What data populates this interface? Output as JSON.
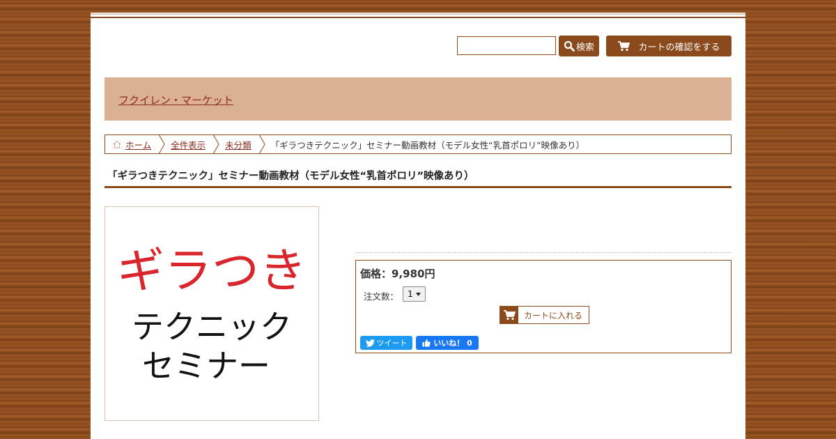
{
  "header": {
    "search_value": "",
    "search_button_label": "検索",
    "cart_button_label": "カートの確認をする"
  },
  "shop": {
    "name": "フクイレン・マーケット"
  },
  "breadcrumb": {
    "items": [
      "ホーム",
      "全件表示",
      "未分類"
    ],
    "current": "「ギラつきテクニック」セミナー動画教材（モデル女性“乳首ポロリ”映像あり）"
  },
  "product": {
    "title": "「ギラつきテクニック」セミナー動画教材（モデル女性“乳首ポロリ”映像あり）",
    "image_text": {
      "line1": "ギラつき",
      "line2": "テクニック",
      "line3": "セミナー"
    },
    "price_label": "価格：9,980円",
    "quantity_label": "注文数：",
    "quantity_value": "1",
    "add_to_cart_label": "カートに入れる",
    "tweet_label": "ツイート",
    "like_label": "いいね！ 0"
  },
  "colors": {
    "accent": "#8a4a1c",
    "banner": "#dcb093",
    "link": "#8b2a1e",
    "image_red": "#d9262c"
  }
}
